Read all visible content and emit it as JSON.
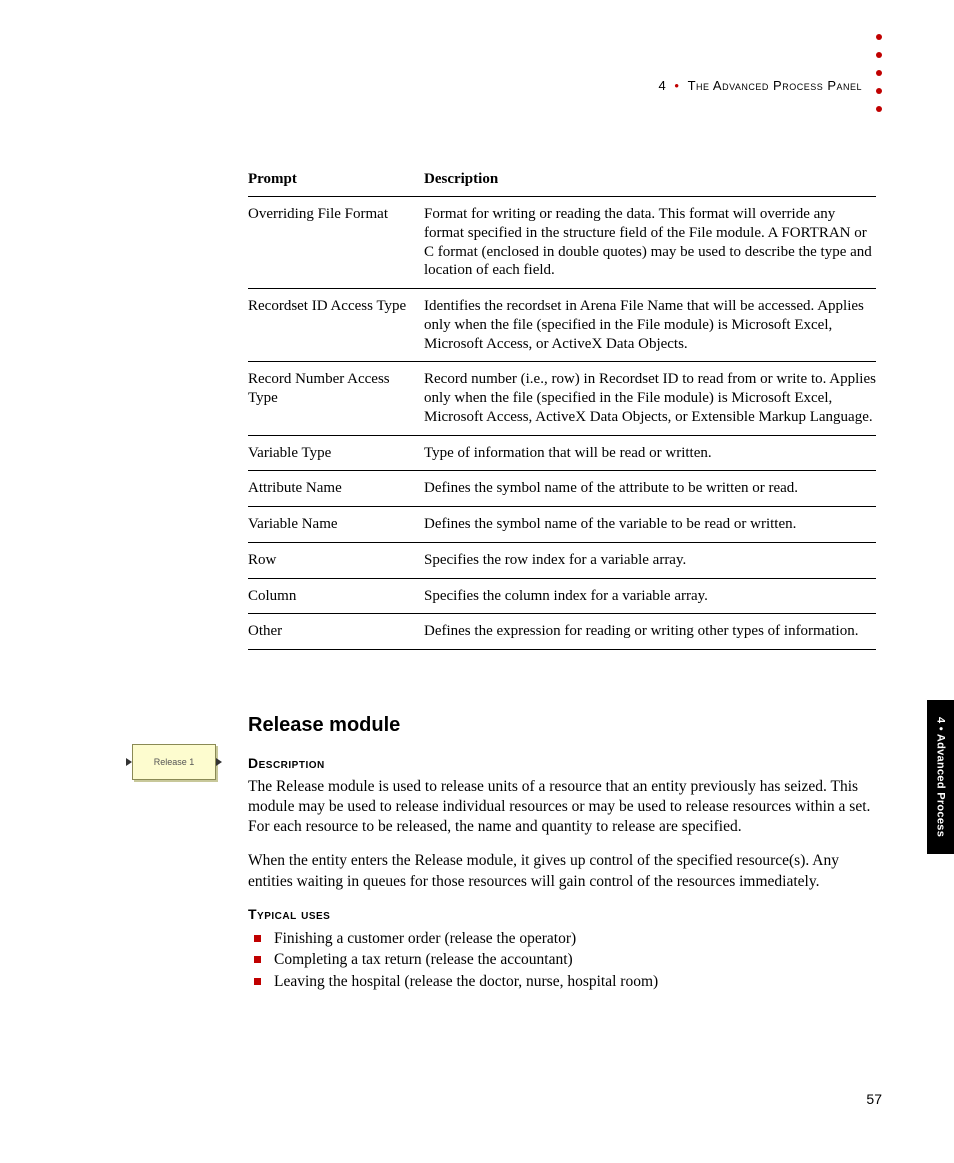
{
  "header": {
    "chapter_num": "4",
    "bullet": "•",
    "chapter_title": "The Advanced Process Panel"
  },
  "table": {
    "head_prompt": "Prompt",
    "head_desc": "Description",
    "rows": [
      {
        "prompt": "Overriding File Format",
        "desc": "Format for writing or reading the data. This format will override any format specified in the structure field of the File module. A FORTRAN or C format (enclosed in double quotes) may be used to describe the type and location of each field."
      },
      {
        "prompt": "Recordset ID Access Type",
        "desc": "Identifies the recordset in Arena File Name that will be accessed. Applies only when the file (specified in the File module) is Microsoft Excel, Microsoft Access, or ActiveX Data Objects."
      },
      {
        "prompt": "Record Number Access Type",
        "desc": "Record number (i.e., row) in Recordset ID to read from or write to. Applies only when the file (specified in the File module) is Microsoft Excel, Microsoft Access, ActiveX Data Objects, or Extensible Markup Language."
      },
      {
        "prompt": "Variable Type",
        "desc": "Type of information that will be read or written."
      },
      {
        "prompt": "Attribute Name",
        "desc": "Defines the symbol name of the attribute to be written or read."
      },
      {
        "prompt": "Variable Name",
        "desc": "Defines the symbol name of the variable to be read or written."
      },
      {
        "prompt": "Row",
        "desc": "Specifies the row index for a variable array."
      },
      {
        "prompt": "Column",
        "desc": "Specifies the column index for a variable array."
      },
      {
        "prompt": "Other",
        "desc": "Defines the expression for reading or writing other types of information."
      }
    ]
  },
  "section": {
    "title": "Release module",
    "desc_head": "Description",
    "para1": "The Release module is used to release units of a resource that an entity previously has seized. This module may be used to release individual resources or may be used to release resources within a set. For each resource to be released, the name and quantity to release are specified.",
    "para2": "When the entity enters the Release module, it gives up control of the specified resource(s). Any entities waiting in queues for those resources will gain control of the resources immediately.",
    "uses_head": "Typical uses",
    "uses": [
      "Finishing a customer order (release the operator)",
      "Completing a tax return (release the accountant)",
      "Leaving the hospital (release the doctor, nurse, hospital room)"
    ]
  },
  "module_icon_label": "Release 1",
  "side_tab": "4 • Advanced Process",
  "page_number": "57"
}
